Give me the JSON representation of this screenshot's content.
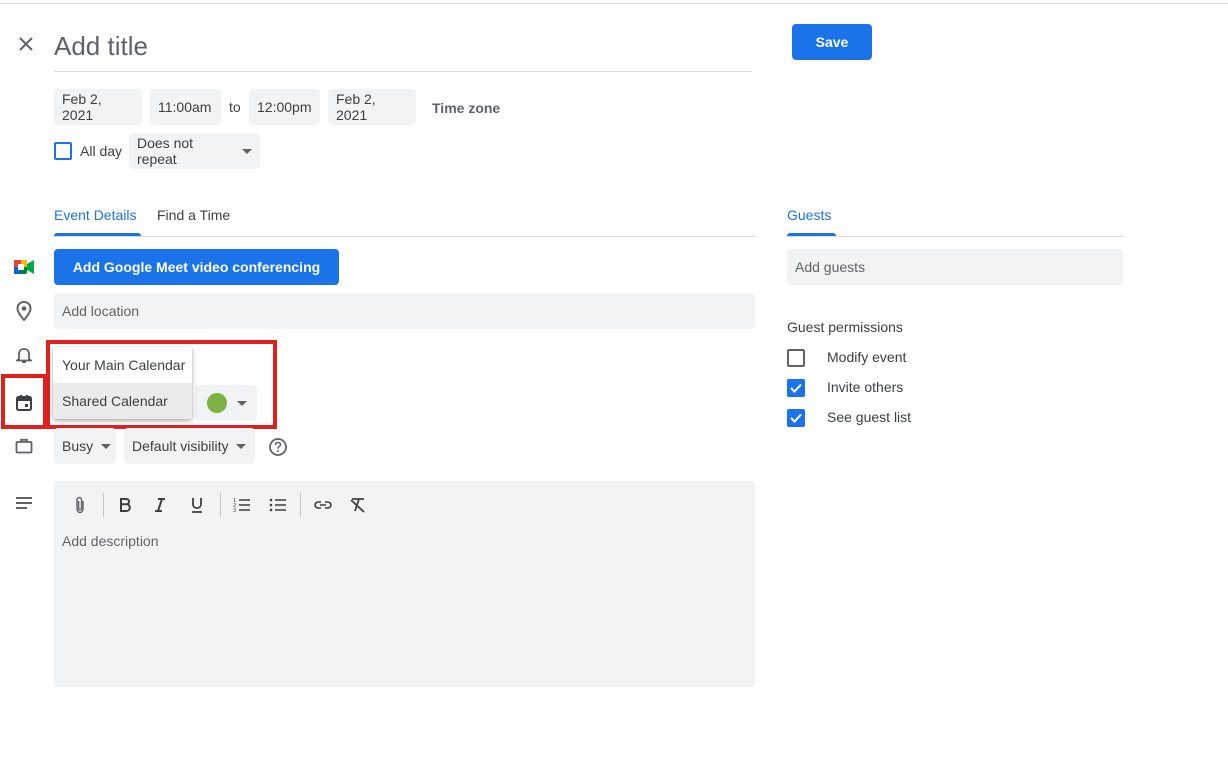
{
  "header": {
    "title_placeholder": "Add title",
    "save_label": "Save"
  },
  "datetime": {
    "start_date": "Feb 2, 2021",
    "start_time": "11:00am",
    "to_label": "to",
    "end_time": "12:00pm",
    "end_date": "Feb 2, 2021",
    "timezone_label": "Time zone",
    "all_day_label": "All day",
    "all_day_checked": false,
    "repeat_value": "Does not repeat"
  },
  "tabs": [
    {
      "label": "Event Details",
      "active": true
    },
    {
      "label": "Find a Time",
      "active": false
    }
  ],
  "details": {
    "meet_button_label": "Add Google Meet video conferencing",
    "location_placeholder": "Add location",
    "calendar_options": [
      "Your Main Calendar",
      "Shared Calendar"
    ],
    "calendar_color": "#7cb342",
    "availability_value": "Busy",
    "visibility_value": "Default visibility",
    "description_placeholder": "Add description"
  },
  "guests": {
    "tab_label": "Guests",
    "add_placeholder": "Add guests",
    "permissions_title": "Guest permissions",
    "permissions": [
      {
        "label": "Modify event",
        "checked": false
      },
      {
        "label": "Invite others",
        "checked": true
      },
      {
        "label": "See guest list",
        "checked": true
      }
    ]
  },
  "colors": {
    "accent": "#1a73e8",
    "highlight_box": "#e0201e"
  },
  "icons": {
    "close": "close-icon",
    "meet": "google-meet-icon",
    "location": "location-pin-icon",
    "notification": "bell-icon",
    "calendar": "calendar-icon",
    "availability": "briefcase-icon",
    "description": "description-lines-icon",
    "help": "help-circle-icon"
  }
}
